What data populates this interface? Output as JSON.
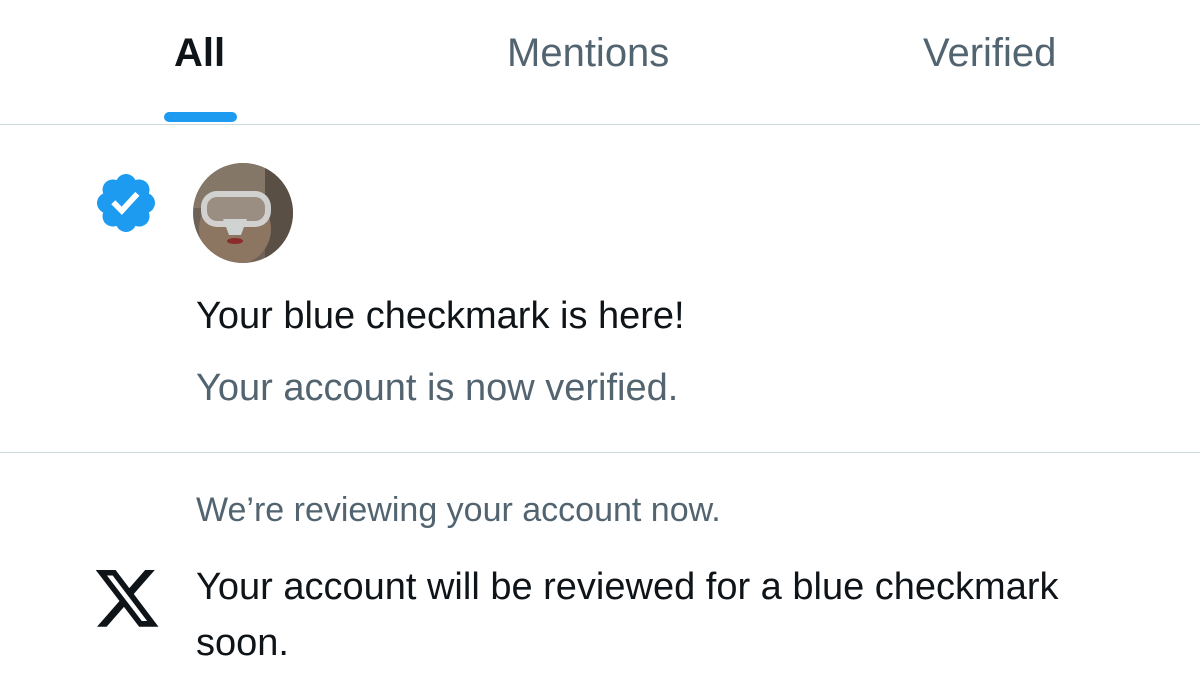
{
  "tabs": [
    {
      "label": "All",
      "active": true
    },
    {
      "label": "Mentions",
      "active": false
    },
    {
      "label": "Verified",
      "active": false
    }
  ],
  "accent_color": "#1d9bf0",
  "notifications": [
    {
      "icon": "verified-badge-icon",
      "avatar": "user-avatar",
      "title": "Your blue checkmark is here!",
      "subtitle": "Your account is now verified."
    },
    {
      "icon": "x-logo-icon",
      "context": "We’re reviewing your account now.",
      "body": "Your account will be reviewed for a blue checkmark soon."
    }
  ]
}
